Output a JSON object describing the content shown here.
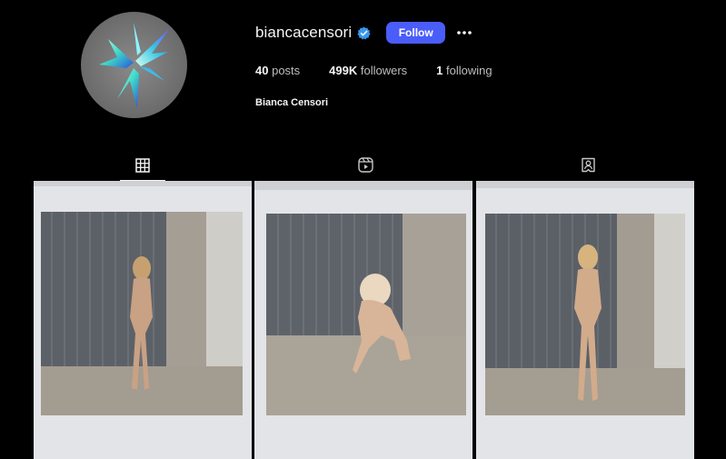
{
  "profile": {
    "username": "biancacensori",
    "verified": true,
    "follow_label": "Follow",
    "full_name": "Bianca Censori",
    "avatar_icon": "butterfly-logo-icon"
  },
  "stats": {
    "posts_count": "40",
    "posts_label": "posts",
    "followers_count": "499K",
    "followers_label": "followers",
    "following_count": "1",
    "following_label": "following"
  },
  "tabs": [
    {
      "name": "posts",
      "icon": "grid-icon",
      "active": true
    },
    {
      "name": "reels",
      "icon": "reels-icon",
      "active": false
    },
    {
      "name": "tagged",
      "icon": "tagged-icon",
      "active": false
    }
  ],
  "posts": [
    {
      "description_icon": "polaroid-photo"
    },
    {
      "description_icon": "polaroid-photo"
    },
    {
      "description_icon": "polaroid-photo"
    }
  ],
  "colors": {
    "background": "#000000",
    "follow_button": "#4a5df9",
    "verified_badge": "#3897f0"
  }
}
